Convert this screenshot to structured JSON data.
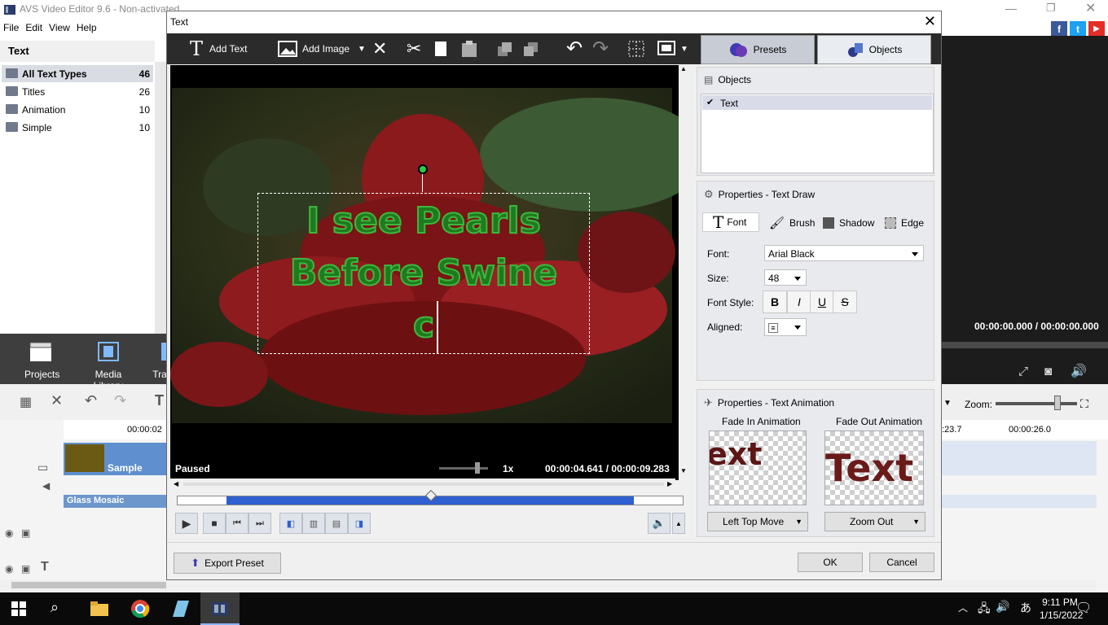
{
  "app": {
    "title": "AVS Video Editor 9.6 - Non-activated",
    "menu": [
      "File",
      "Edit",
      "View",
      "Help"
    ],
    "left_panel_title": "Text",
    "categories": [
      {
        "label": "All Text Types",
        "count": "46"
      },
      {
        "label": "Titles",
        "count": "26"
      },
      {
        "label": "Animation",
        "count": "10"
      },
      {
        "label": "Simple",
        "count": "10"
      }
    ],
    "nav": {
      "projects": "Projects",
      "media_library": "Media Library",
      "transitions": "Tra"
    },
    "player_time": "00:00:00.000 / 00:00:00.000",
    "zoom_label": "Zoom:",
    "ruler": {
      "left": "00:00:02",
      "mid": ":23.7",
      "right": "00:00:26.0"
    },
    "track": {
      "clip": "Sample",
      "effect": "Glass Mosaic"
    },
    "social": {
      "facebook": "f",
      "twitter": "t",
      "youtube": "▶"
    }
  },
  "dialog": {
    "title": "Text",
    "toolbar": {
      "add_text": "Add Text",
      "add_image": "Add Image"
    },
    "tabs": {
      "presets": "Presets",
      "objects": "Objects"
    },
    "preview": {
      "line1": "I see Pearls",
      "line2": "Before Swine",
      "line3": "c",
      "status": "Paused",
      "speed": "1x",
      "time": "00:00:04.641 / 00:00:09.283"
    },
    "objects": {
      "header": "Objects",
      "items": [
        "Text"
      ]
    },
    "properties": {
      "header": "Properties - Text Draw",
      "tabs": {
        "font": "Font",
        "brush": "Brush",
        "shadow": "Shadow",
        "edge": "Edge"
      },
      "font_label": "Font:",
      "font_value": "Arial Black",
      "size_label": "Size:",
      "size_value": "48",
      "style_label": "Font Style:",
      "styles": {
        "bold": "B",
        "italic": "I",
        "underline": "U",
        "strike": "S"
      },
      "aligned_label": "Aligned:"
    },
    "animation": {
      "header": "Properties - Text Animation",
      "fade_in_label": "Fade In Animation",
      "fade_out_label": "Fade Out Animation",
      "fade_in_preview": "ext",
      "fade_out_preview": "Text",
      "fade_in_value": "Left Top Move",
      "fade_out_value": "Zoom Out"
    },
    "footer": {
      "export": "Export Preset",
      "ok": "OK",
      "cancel": "Cancel"
    }
  },
  "taskbar": {
    "time": "9:11 PM",
    "date": "1/15/2022"
  },
  "colors": {
    "text_fill": "#1f7a1f",
    "text_outline": "#3db83d",
    "accent": "#2f5fd0"
  }
}
